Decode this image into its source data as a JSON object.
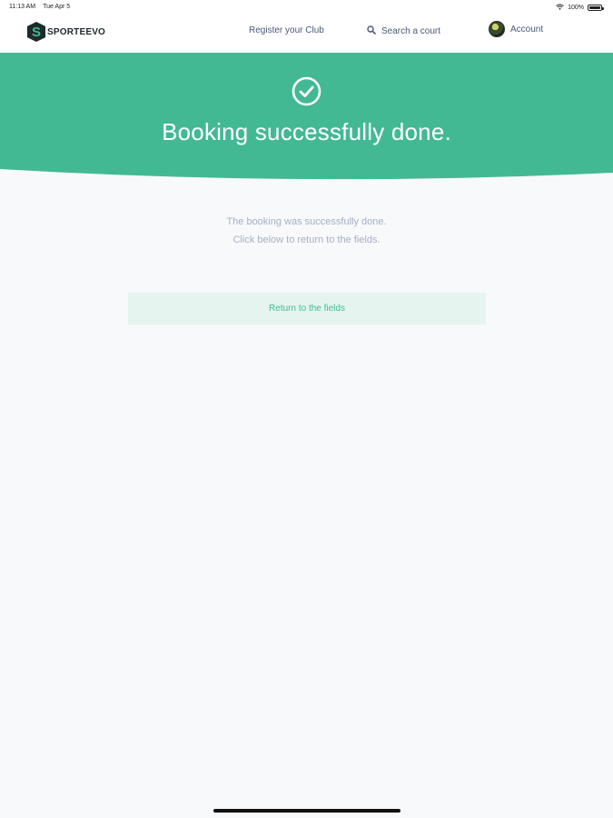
{
  "status_bar": {
    "time": "11:13 AM",
    "date": "Tue Apr 5",
    "battery": "100%",
    "icons": [
      "wifi-icon",
      "battery-icon"
    ]
  },
  "nav": {
    "brand": "SPORTEEVO",
    "register_label": "Register your Club",
    "search_label": "Search a court",
    "account_label": "Account"
  },
  "hero": {
    "title": "Booking successfully done.",
    "icon": "check-circle-icon"
  },
  "body": {
    "line1": "The booking was successfully done.",
    "line2": "Click below to return to the fields.",
    "button_label": "Return to the fields"
  },
  "colors": {
    "accent": "#3fbd93",
    "background": "#f7f9fb",
    "button_bg": "#e5f4ef",
    "muted_text": "#a7afc4",
    "nav_text": "#4a5876"
  }
}
